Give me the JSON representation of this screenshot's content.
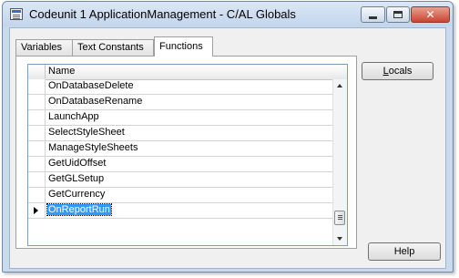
{
  "window": {
    "title": "Codeunit 1 ApplicationManagement - C/AL Globals",
    "close_symbol": "✕"
  },
  "tabs": [
    {
      "label": "Variables"
    },
    {
      "label": "Text Constants"
    },
    {
      "label": "Functions"
    }
  ],
  "active_tab": "Functions",
  "grid": {
    "column_name": "Name",
    "rows": [
      {
        "name": "OnDatabaseDelete"
      },
      {
        "name": "OnDatabaseRename"
      },
      {
        "name": "LaunchApp"
      },
      {
        "name": "SelectStyleSheet"
      },
      {
        "name": "ManageStyleSheets"
      },
      {
        "name": "GetUidOffset"
      },
      {
        "name": "GetGLSetup"
      },
      {
        "name": "GetCurrency"
      },
      {
        "name": "OnReportRun"
      }
    ],
    "current_row": "OnReportRun"
  },
  "buttons": {
    "locals_accel": "L",
    "locals_rest": "ocals",
    "help": "Help"
  }
}
